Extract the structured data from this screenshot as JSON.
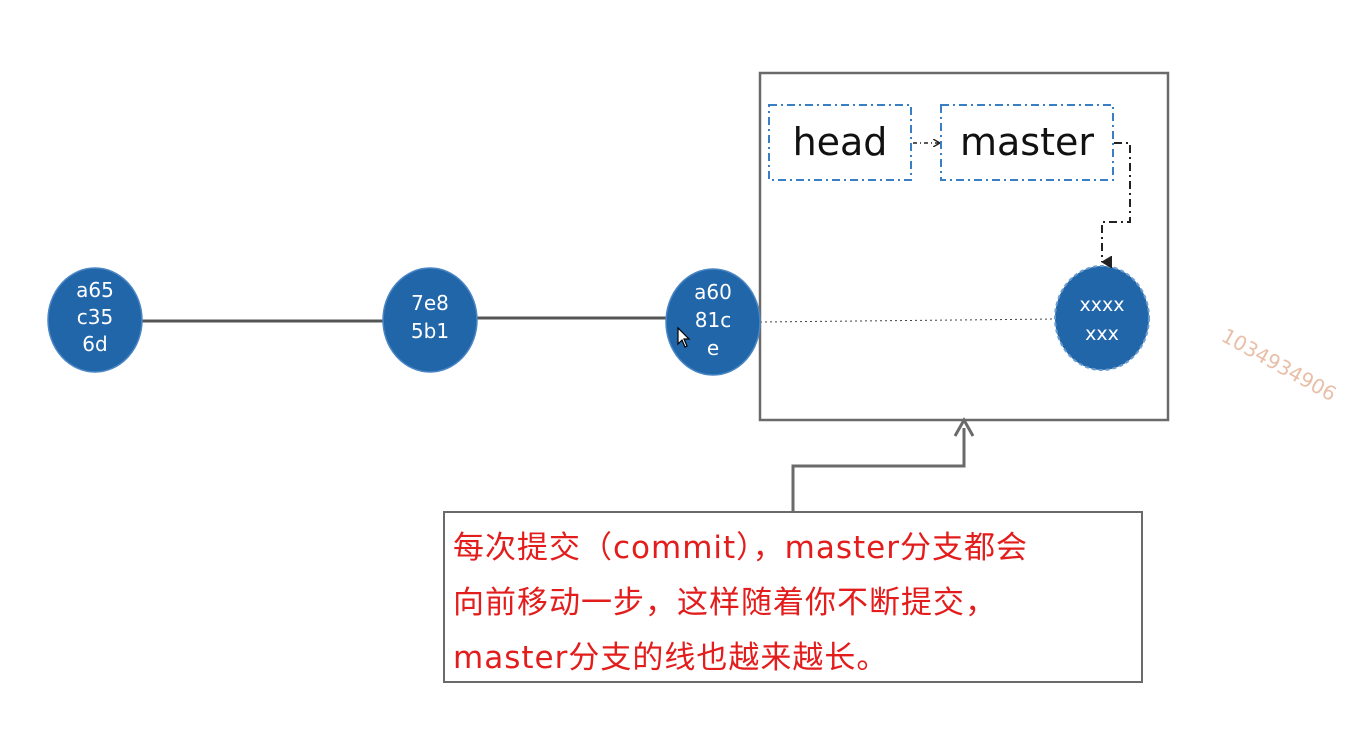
{
  "commits": [
    {
      "lines": [
        "a65",
        "c35",
        "6d"
      ]
    },
    {
      "lines": [
        "7e8",
        "5b1"
      ]
    },
    {
      "lines": [
        "a60",
        "81c",
        "e"
      ]
    },
    {
      "lines": [
        "xxxx",
        "xxx"
      ]
    }
  ],
  "pointers": {
    "head_label": "head",
    "master_label": "master"
  },
  "note": {
    "lines": [
      "每次提交（commit），master分支都会",
      "向前移动一步，这样随着你不断提交，",
      "master分支的线也越来越长。"
    ]
  },
  "watermark": "1034934906",
  "colors": {
    "node_fill": "#2266aa",
    "pointer_border": "#3a7fc4",
    "note_text": "#e31c1c",
    "frame": "#6a6a6a",
    "line": "#555555"
  }
}
